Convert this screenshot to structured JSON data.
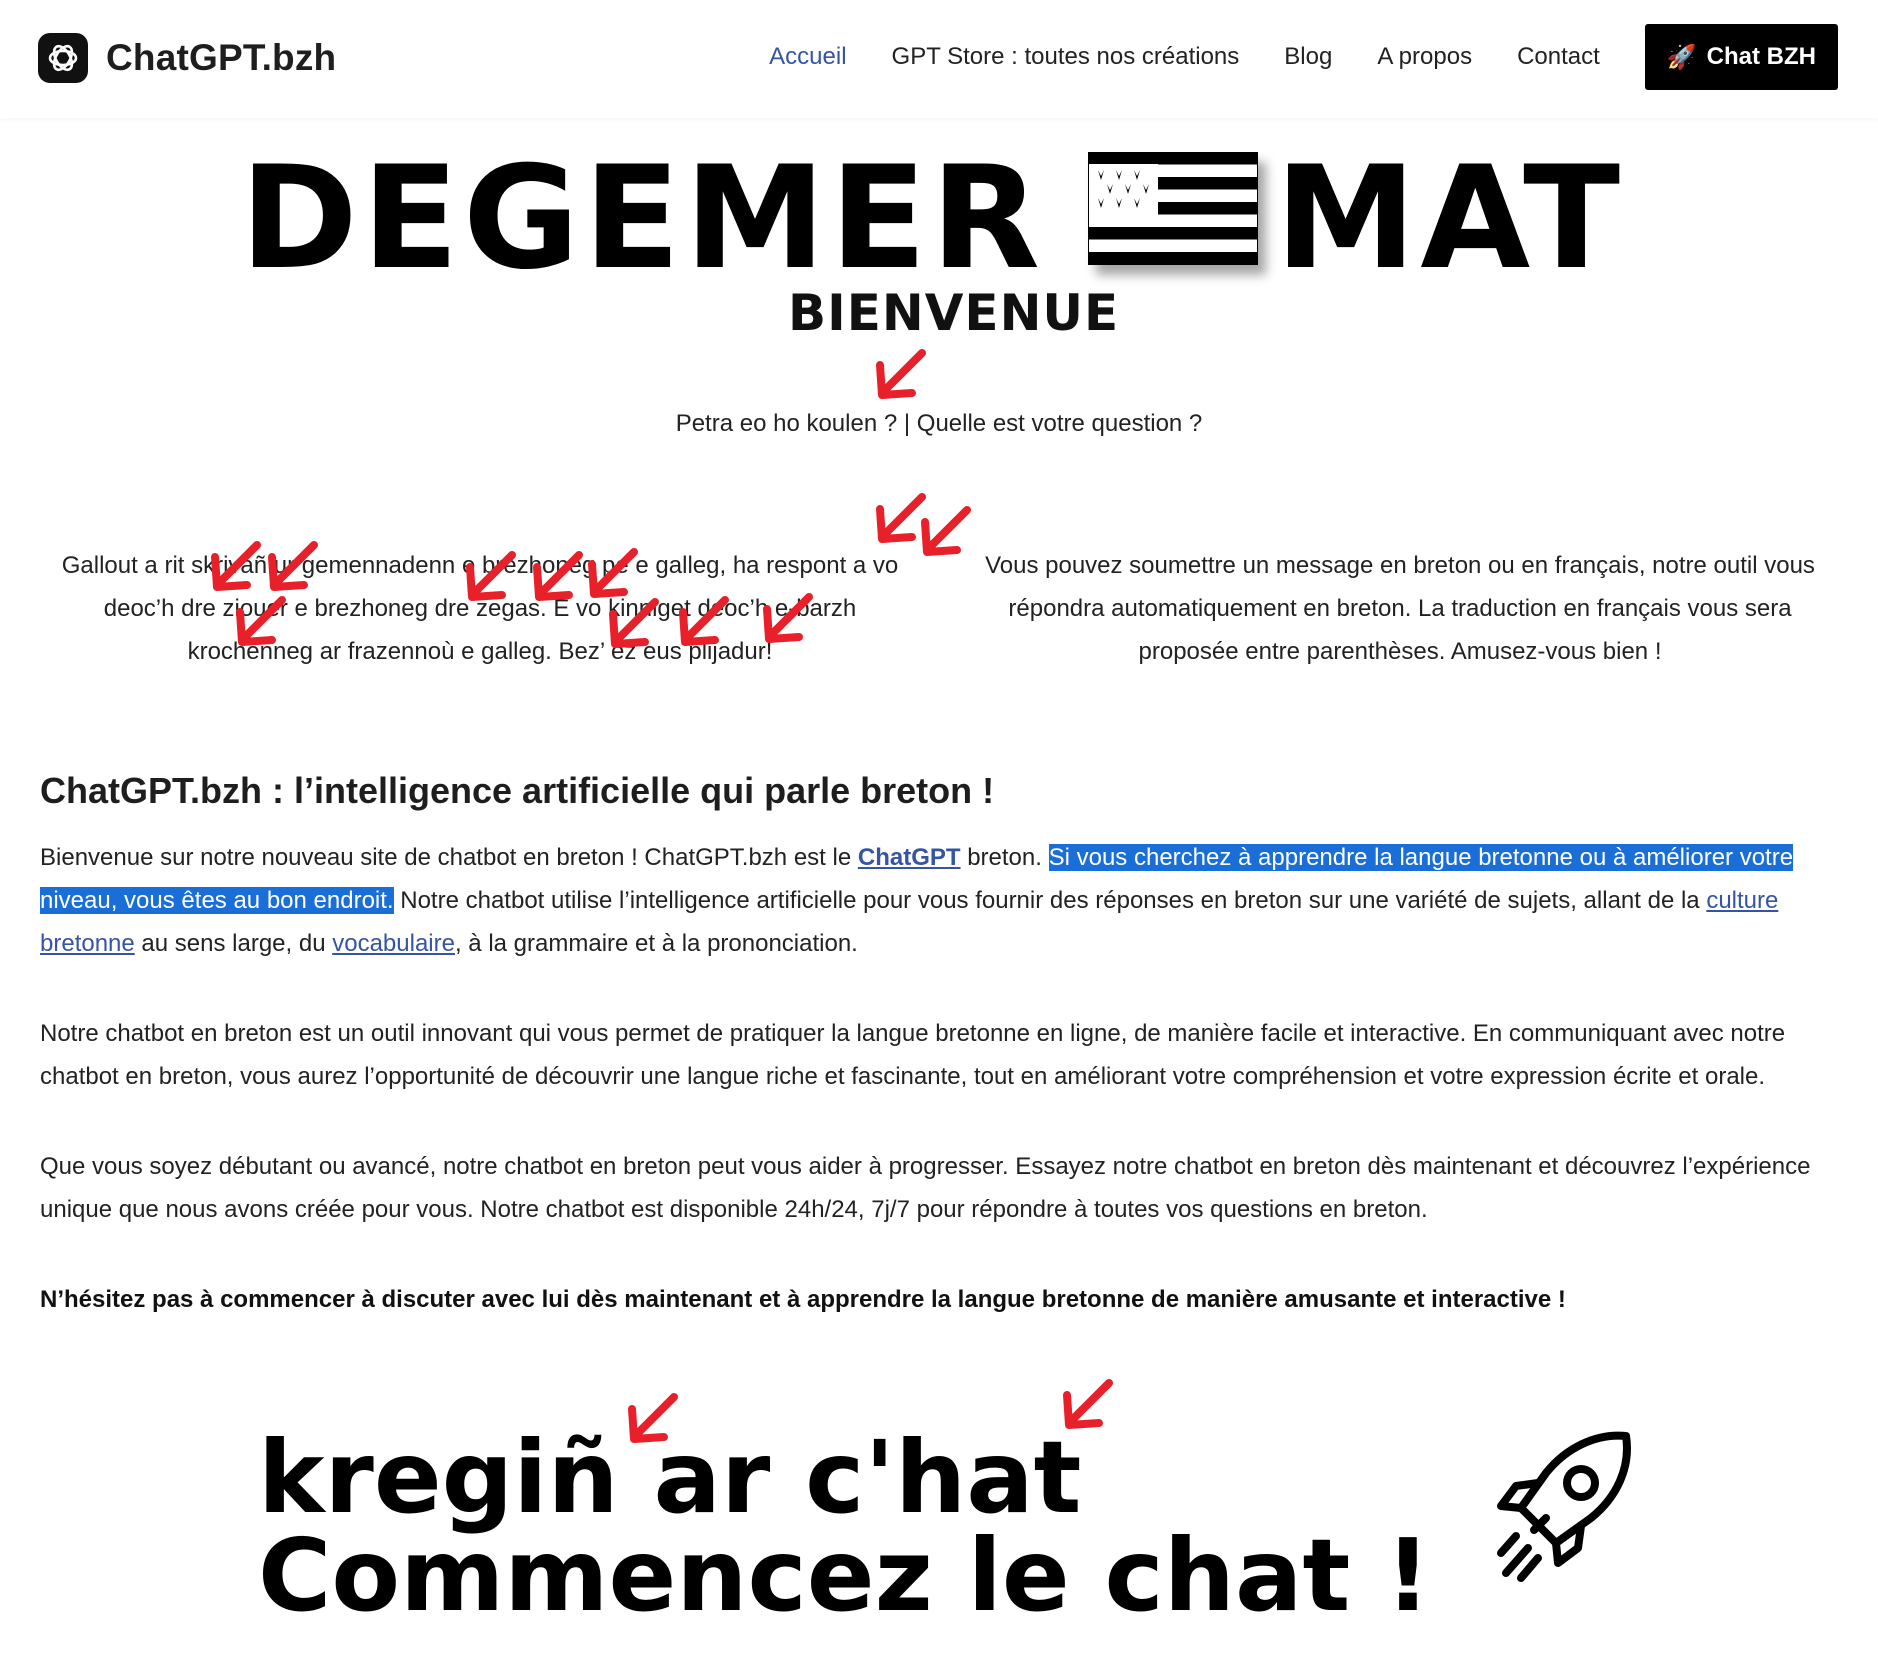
{
  "header": {
    "brand": "ChatGPT.bzh",
    "nav": [
      "Accueil",
      "GPT Store : toutes nos créations",
      "Blog",
      "A propos",
      "Contact"
    ],
    "cta_label": "Chat BZH",
    "cta_icon": "rocket-icon",
    "active_color": "#3555a4"
  },
  "hero": {
    "word1": "DEGEMER",
    "word2": "MAT",
    "subtitle": "BIENVENUE"
  },
  "question": "Petra eo ho koulen ? | Quelle est votre question ?",
  "intro": {
    "breton": "Gallout a rit skrivañ ur gemennadenn e brezhoneg pe e galleg, ha respont a vo deoc’h dre ziouer e brezhoneg dre zegas. E vo kinniget deoc’h e-barzh krochenneg ar frazennoù e galleg. Bez’ ez eus plijadur!",
    "french": "Vous pouvez soumettre un message en breton ou en français, notre outil vous répondra automatiquement en breton. La traduction en français vous sera proposée entre parenthèses. Amusez-vous bien !"
  },
  "article": {
    "title": "ChatGPT.bzh : l’intelligence artificielle qui parle breton !",
    "p1_before": "Bienvenue sur notre nouveau site de chatbot en breton ! ChatGPT.bzh est le ",
    "p1_link": "ChatGPT",
    "p1_mid": " breton. ",
    "p1_highlight": "Si vous cherchez à apprendre la langue bretonne ou à améliorer votre niveau, vous êtes au bon endroit.",
    "p1_after": " Notre chatbot utilise l’intelligence artificielle pour vous fournir des réponses en breton sur une variété de sujets, allant de la ",
    "p1_link2": "culture bretonne",
    "p1_after2": " au sens large, du ",
    "p1_link3": "vocabulaire",
    "p1_end": ", à la grammaire et à la prononciation.",
    "p2": "Notre chatbot en breton est un outil innovant qui vous permet de pratiquer la langue bretonne en ligne, de manière facile et interactive. En communiquant avec notre chatbot en breton, vous aurez l’opportunité de découvrir une langue riche et fascinante, tout en améliorant votre compréhension et votre expression écrite et orale.",
    "p3": "Que vous soyez débutant ou avancé, notre chatbot en breton peut vous aider à progresser. Essayez notre chatbot en breton dès maintenant et découvrez l’expérience unique que nous avons créée pour vous. Notre chatbot est disponible 24h/24, 7j/7 pour répondre à toutes vos questions en breton.",
    "p4": "N’hésitez pas à commencer à discuter avec lui dès maintenant et à apprendre la langue bretonne de manière amusante et interactive !"
  },
  "cta_image": {
    "line1": "kregiñ ar c'hat",
    "line2": "Commencez le chat !"
  },
  "colors": {
    "highlight": "#1a6ed8",
    "link": "#3555a4",
    "annotation_arrow": "#e8202a"
  }
}
